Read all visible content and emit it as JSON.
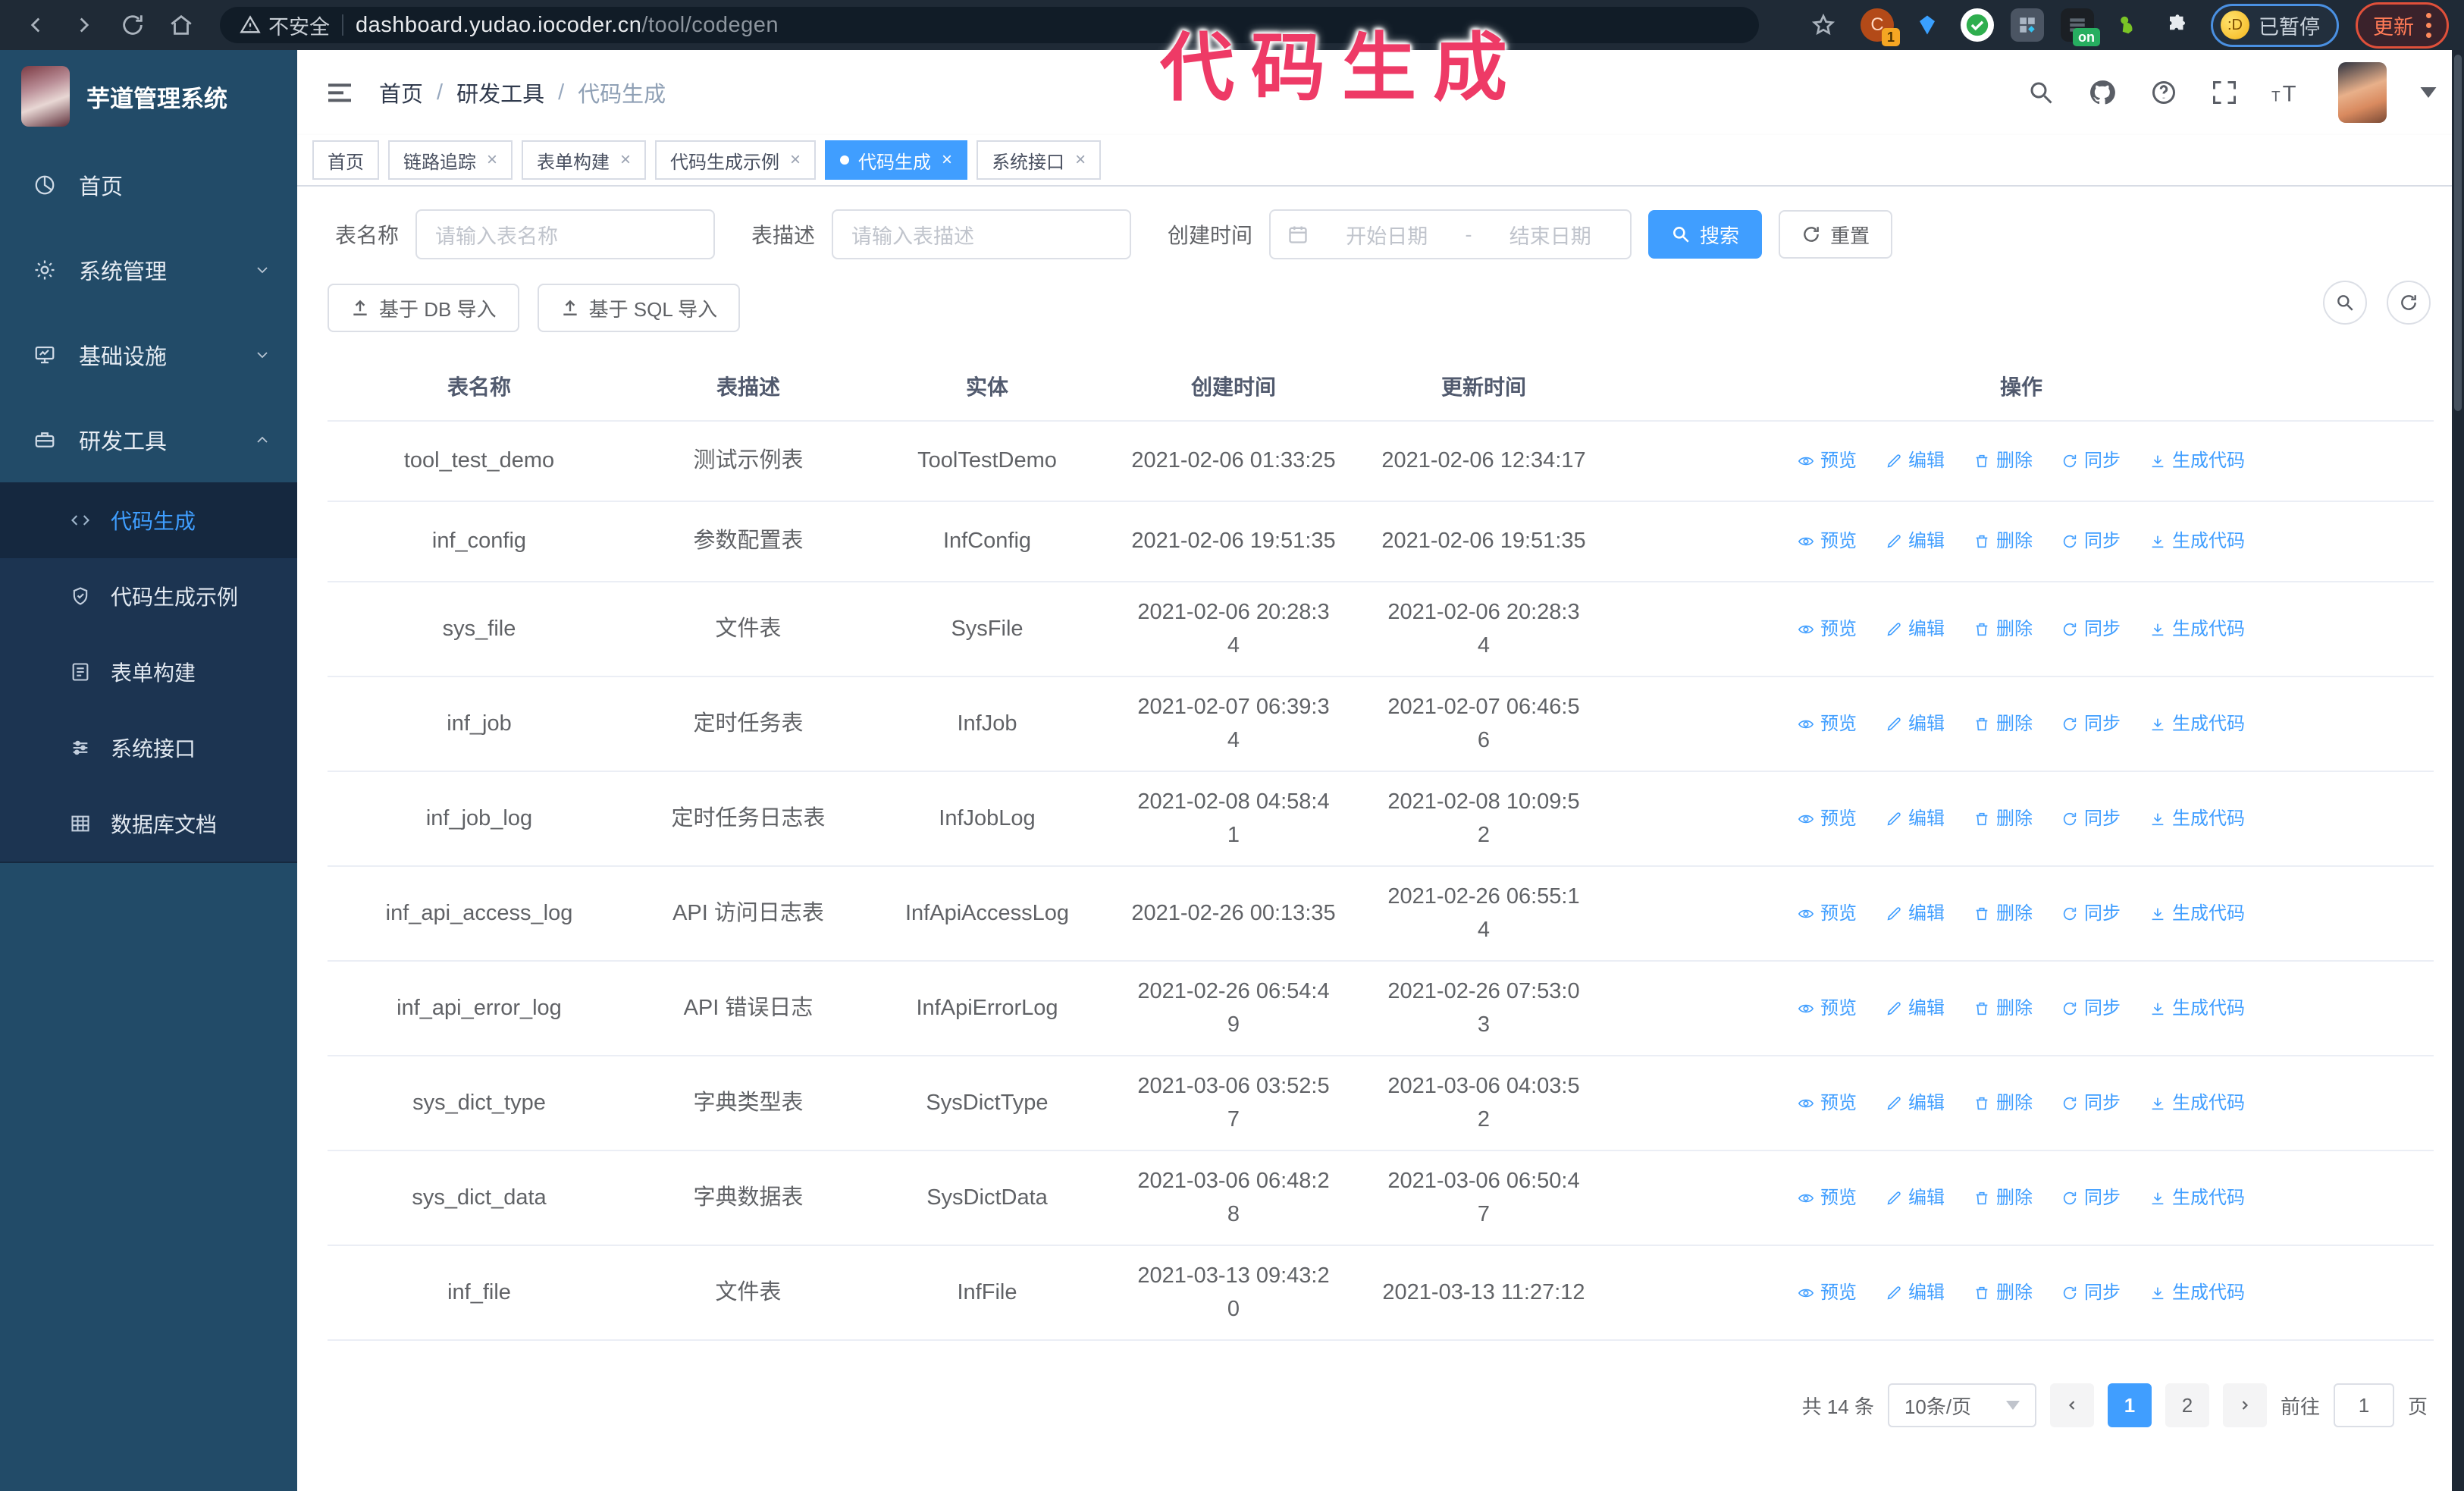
{
  "browser": {
    "security_warning": "不安全",
    "url_host": "dashboard.yudao.iocoder.cn",
    "url_path": "/tool/codegen",
    "extension_badge": "1",
    "extension_on_badge": "on",
    "paused_badge": "已暂停",
    "update_button": "更新"
  },
  "annotation": "代码生成",
  "sidebar": {
    "logo_title": "芋道管理系统",
    "items": [
      {
        "label": "首页",
        "icon": "dashboard",
        "chevron": "none"
      },
      {
        "label": "系统管理",
        "icon": "gear",
        "chevron": "down"
      },
      {
        "label": "基础设施",
        "icon": "monitor",
        "chevron": "down"
      },
      {
        "label": "研发工具",
        "icon": "toolbox",
        "chevron": "up"
      }
    ],
    "submenu": [
      {
        "label": "代码生成",
        "icon": "code",
        "active": true
      },
      {
        "label": "代码生成示例",
        "icon": "shield",
        "active": false
      },
      {
        "label": "表单构建",
        "icon": "form",
        "active": false
      },
      {
        "label": "系统接口",
        "icon": "sliders",
        "active": false
      },
      {
        "label": "数据库文档",
        "icon": "grid",
        "active": false
      }
    ]
  },
  "navbar": {
    "breadcrumb": [
      "首页",
      "研发工具",
      "代码生成"
    ],
    "separator": "/"
  },
  "tabs": [
    {
      "label": "首页",
      "closable": false,
      "active": false
    },
    {
      "label": "链路追踪",
      "closable": true,
      "active": false
    },
    {
      "label": "表单构建",
      "closable": true,
      "active": false
    },
    {
      "label": "代码生成示例",
      "closable": true,
      "active": false
    },
    {
      "label": "代码生成",
      "closable": true,
      "active": true
    },
    {
      "label": "系统接口",
      "closable": true,
      "active": false
    }
  ],
  "filters": {
    "table_name_label": "表名称",
    "table_name_placeholder": "请输入表名称",
    "table_desc_label": "表描述",
    "table_desc_placeholder": "请输入表描述",
    "create_time_label": "创建时间",
    "date_start_placeholder": "开始日期",
    "date_separator": "-",
    "date_end_placeholder": "结束日期",
    "search_button": "搜索",
    "reset_button": "重置"
  },
  "toolbar": {
    "import_db_button": "基于 DB 导入",
    "import_sql_button": "基于 SQL 导入"
  },
  "table": {
    "columns": [
      "表名称",
      "表描述",
      "实体",
      "创建时间",
      "更新时间",
      "操作"
    ],
    "actions": [
      "预览",
      "编辑",
      "删除",
      "同步",
      "生成代码"
    ],
    "rows": [
      {
        "name": "tool_test_demo",
        "desc": "测试示例表",
        "entity": "ToolTestDemo",
        "created": "2021-02-06 01:33:25",
        "updated": "2021-02-06 12:34:17"
      },
      {
        "name": "inf_config",
        "desc": "参数配置表",
        "entity": "InfConfig",
        "created": "2021-02-06 19:51:35",
        "updated": "2021-02-06 19:51:35"
      },
      {
        "name": "sys_file",
        "desc": "文件表",
        "entity": "SysFile",
        "created": "2021-02-06 20:28:3\n4",
        "updated": "2021-02-06 20:28:3\n4"
      },
      {
        "name": "inf_job",
        "desc": "定时任务表",
        "entity": "InfJob",
        "created": "2021-02-07 06:39:3\n4",
        "updated": "2021-02-07 06:46:5\n6"
      },
      {
        "name": "inf_job_log",
        "desc": "定时任务日志表",
        "entity": "InfJobLog",
        "created": "2021-02-08 04:58:4\n1",
        "updated": "2021-02-08 10:09:5\n2"
      },
      {
        "name": "inf_api_access_log",
        "desc": "API 访问日志表",
        "entity": "InfApiAccessLog",
        "created": "2021-02-26 00:13:35",
        "updated": "2021-02-26 06:55:1\n4"
      },
      {
        "name": "inf_api_error_log",
        "desc": "API 错误日志",
        "entity": "InfApiErrorLog",
        "created": "2021-02-26 06:54:4\n9",
        "updated": "2021-02-26 07:53:0\n3"
      },
      {
        "name": "sys_dict_type",
        "desc": "字典类型表",
        "entity": "SysDictType",
        "created": "2021-03-06 03:52:5\n7",
        "updated": "2021-03-06 04:03:5\n2"
      },
      {
        "name": "sys_dict_data",
        "desc": "字典数据表",
        "entity": "SysDictData",
        "created": "2021-03-06 06:48:2\n8",
        "updated": "2021-03-06 06:50:4\n7"
      },
      {
        "name": "inf_file",
        "desc": "文件表",
        "entity": "InfFile",
        "created": "2021-03-13 09:43:2\n0",
        "updated": "2021-03-13 11:27:12"
      }
    ]
  },
  "pagination": {
    "total_text": "共 14 条",
    "page_size": "10条/页",
    "pages": [
      "1",
      "2"
    ],
    "active_page": "1",
    "goto_label": "前往",
    "goto_value": "1",
    "page_label": "页"
  },
  "colors": {
    "primary": "#409eff",
    "sidebar": "#224b68",
    "submenu": "#1c3451",
    "annotation": "#ee3a66"
  }
}
